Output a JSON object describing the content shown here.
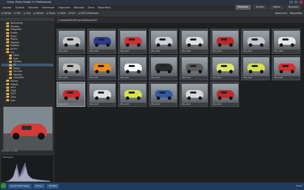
{
  "app": {
    "title": "Zoner Photo Studio 11 Professional"
  },
  "menu": [
    "Soubor",
    "Upravit",
    "Zobrazit",
    "Informace",
    "Organizer",
    "Nástroje",
    "Okno",
    "Nápověda"
  ],
  "modes": [
    "Manažer",
    "Viewer",
    "Editor",
    "Browser"
  ],
  "toolbar": {
    "left": [
      "Pořadí",
      "Filtr",
      "Tisk",
      "Hledat",
      "Email",
      "Web",
      "PDF",
      "DVD Slideshow"
    ],
    "right": [
      "Nastavení",
      "Nápověda"
    ]
  },
  "folders": [
    "Dokumenty",
    "Obrázky",
    "Fotografie",
    "Hudba",
    "Video",
    "Plocha",
    "Stažené",
    "Projekty",
    "Archiv",
    "Hry",
    "Sport",
    "Auta",
    "Závody",
    "GT",
    "Rallye",
    "Formule",
    "Motorky",
    "Cestování",
    "Rodina",
    "Přátelé",
    "Akce",
    "2006",
    "2007",
    "Zima",
    "Léto"
  ],
  "path": "C:\\Users\\Petr\\Pictures\\Závody\\GT",
  "thumbs": [
    {
      "cap": "IMG_0001"
    },
    {
      "cap": "IMG_0002"
    },
    {
      "cap": "IMG_0003"
    },
    {
      "cap": "IMG_0004"
    },
    {
      "cap": "IMG_0005"
    },
    {
      "cap": "IMG_0006"
    },
    {
      "cap": "IMG_0007"
    },
    {
      "cap": "IMG_0008"
    },
    {
      "cap": "IMG_0009"
    },
    {
      "cap": "IMG_0010"
    },
    {
      "cap": "IMG_0011"
    },
    {
      "cap": "IMG_0012"
    },
    {
      "cap": "IMG_0013"
    },
    {
      "cap": "IMG_0014"
    },
    {
      "cap": "IMG_0015"
    },
    {
      "cap": "IMG_0016"
    },
    {
      "cap": "IMG_0017"
    },
    {
      "cap": "IMG_0018"
    },
    {
      "cap": "IMG_0019"
    },
    {
      "cap": "IMG_0020"
    },
    {
      "cap": "IMG_0021"
    },
    {
      "cap": "IMG_0022"
    }
  ],
  "car_colors": [
    "#c8c8c8",
    "#2f3a8c",
    "#d03030",
    "#d0d0d8",
    "#e0e0e0",
    "#c02828",
    "#c8c8d0",
    "#e6e6e6",
    "#bfbfbf",
    "#f08a1c",
    "#ffffff",
    "#2a2a2a",
    "#5a5a5a",
    "#dfe86a",
    "#d7e24a",
    "#d03030",
    "#d02828",
    "#e0e0e0",
    "#d7e24a",
    "#2f5aa8",
    "#d8d8d8",
    "#c02828"
  ],
  "selected": 16,
  "info": [
    "File Size: 1.2 MB",
    "Dimensions: 2048 x 1536"
  ],
  "histogram_label": "Histogram",
  "taskbar": [
    "Zoner Photo Studio",
    "Soubor",
    "Obrázky"
  ],
  "clock": "14:32"
}
